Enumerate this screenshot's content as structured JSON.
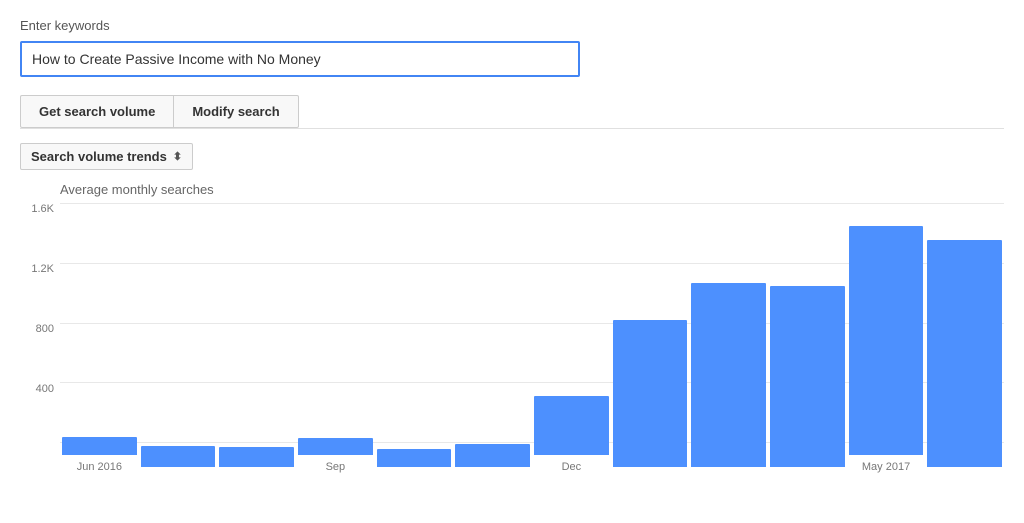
{
  "header": {
    "enter_keywords_label": "Enter keywords",
    "keyword_input_value": "How to Create Passive Income with No Money"
  },
  "buttons": {
    "get_search_volume": "Get search volume",
    "modify_search": "Modify search"
  },
  "chart": {
    "dropdown_label": "Search volume trends",
    "y_axis_label": "Average monthly searches",
    "y_ticks": [
      "1.6K",
      "1.2K",
      "800",
      "400",
      ""
    ],
    "x_labels": [
      "Jun 2016",
      "",
      "",
      "Sep",
      "",
      "",
      "Dec",
      "",
      "",
      "",
      "May 2017",
      ""
    ],
    "bars": [
      {
        "label": "Jun 2016",
        "value": 130,
        "show_label": true
      },
      {
        "label": "",
        "value": 150,
        "show_label": false
      },
      {
        "label": "",
        "value": 140,
        "show_label": false
      },
      {
        "label": "Sep",
        "value": 120,
        "show_label": true
      },
      {
        "label": "",
        "value": 130,
        "show_label": false
      },
      {
        "label": "",
        "value": 160,
        "show_label": false
      },
      {
        "label": "Dec",
        "value": 420,
        "show_label": true
      },
      {
        "label": "",
        "value": 1040,
        "show_label": false
      },
      {
        "label": "",
        "value": 1300,
        "show_label": false
      },
      {
        "label": "",
        "value": 1280,
        "show_label": false
      },
      {
        "label": "May 2017",
        "value": 1620,
        "show_label": true
      },
      {
        "label": "",
        "value": 1610,
        "show_label": false
      }
    ],
    "max_value": 1700
  }
}
